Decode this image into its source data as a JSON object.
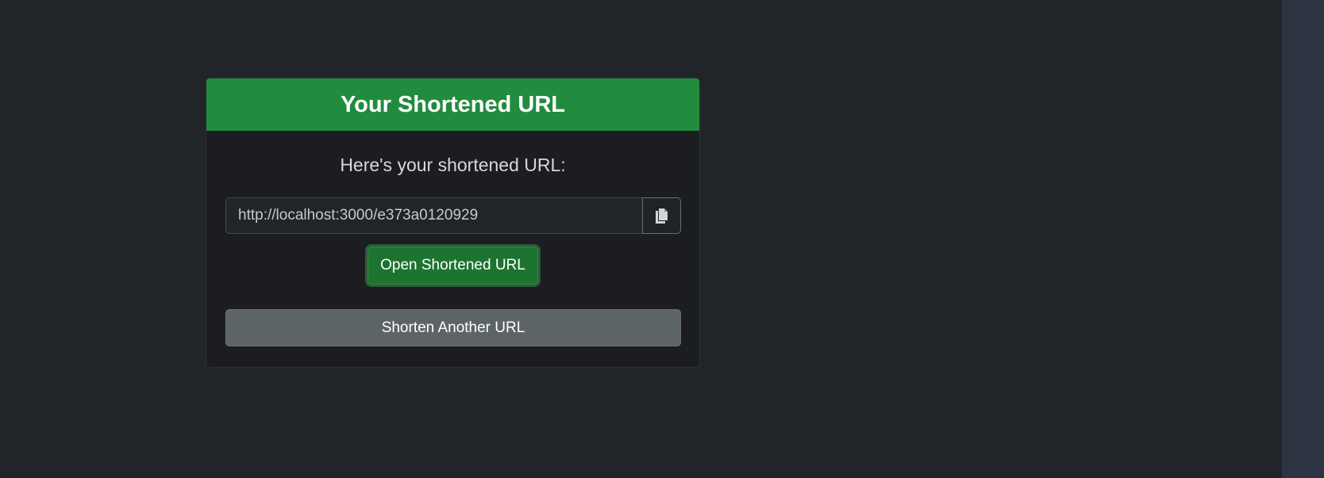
{
  "card": {
    "title": "Your Shortened URL",
    "intro": "Here's your shortened URL:",
    "short_url": "http://localhost:3000/e373a0120929",
    "copy_icon": "copy-icon",
    "open_label": "Open Shortened URL",
    "another_label": "Shorten Another URL"
  },
  "colors": {
    "background": "#212529",
    "header": "#218c3d",
    "primary_button": "#1c7430",
    "secondary_button": "#5d6468"
  }
}
